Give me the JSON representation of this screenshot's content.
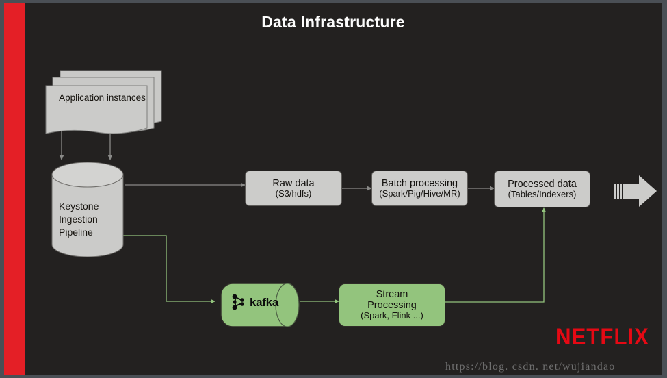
{
  "slide": {
    "title": "Data Infrastructure",
    "background_color": "#232120",
    "frame_color": "#4a4f55",
    "accent_bar_color": "#e41f26",
    "title_color": "#fdfdfd"
  },
  "diagram": {
    "type": "flow-diagram",
    "nodes": {
      "app_instances": {
        "label": "Application instances",
        "shape": "document-stack",
        "fill": "#ccccca"
      },
      "keystone": {
        "label_lines": [
          "Keystone",
          "Ingestion",
          "Pipeline"
        ],
        "shape": "cylinder",
        "fill": "#ccccca"
      },
      "raw_data": {
        "main": "Raw data",
        "sub": "(S3/hdfs)",
        "shape": "rounded-rect",
        "fill": "#ccccca"
      },
      "batch_processing": {
        "main": "Batch processing",
        "sub": "(Spark/Pig/Hive/MR)",
        "shape": "rounded-rect",
        "fill": "#ccccca"
      },
      "processed_data": {
        "main": "Processed data",
        "sub": "(Tables/Indexers)",
        "shape": "rounded-rect",
        "fill": "#ccccca"
      },
      "kafka": {
        "label": "kafka",
        "shape": "horizontal-cylinder",
        "fill": "#93c47d"
      },
      "stream_processing": {
        "line1": "Stream",
        "line2": "Processing",
        "sub": "(Spark, Flink ...)",
        "shape": "rounded-rect",
        "fill": "#93c47d"
      }
    },
    "edges": [
      {
        "from": "app_instances",
        "to": "keystone",
        "color": "#8a8a88",
        "style": "arrow"
      },
      {
        "from": "app_instances",
        "to": "keystone",
        "color": "#8a8a88",
        "style": "arrow"
      },
      {
        "from": "keystone",
        "to": "raw_data",
        "color": "#8a8a88",
        "style": "arrow"
      },
      {
        "from": "raw_data",
        "to": "batch_processing",
        "color": "#8a8a88",
        "style": "arrow"
      },
      {
        "from": "batch_processing",
        "to": "processed_data",
        "color": "#8a8a88",
        "style": "arrow"
      },
      {
        "from": "keystone",
        "to": "kafka",
        "color": "#93c47d",
        "style": "elbow-arrow"
      },
      {
        "from": "kafka",
        "to": "stream_processing",
        "color": "#93c47d",
        "style": "arrow"
      },
      {
        "from": "stream_processing",
        "to": "processed_data",
        "color": "#93c47d",
        "style": "elbow-arrow"
      }
    ],
    "exit_arrow": {
      "name": "output-arrow",
      "fill": "#ccccca"
    }
  },
  "branding": {
    "netflix_wordmark": "NETFLIX",
    "netflix_color": "#e50914"
  },
  "watermark": {
    "text": "https://blog. csdn. net/wujiandao",
    "color": "#6f6f6f"
  }
}
